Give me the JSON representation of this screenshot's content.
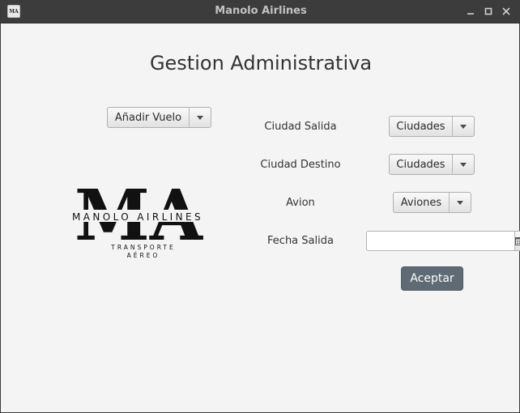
{
  "window": {
    "title": "Manolo Airlines",
    "icon_text": "MA"
  },
  "heading": "Gestion Administrativa",
  "menu": {
    "add_flight_label": "Añadir Vuelo"
  },
  "logo": {
    "monogram": "MA",
    "name": "MANOLO AIRLINES",
    "tagline_1": "TRANSPORTE",
    "tagline_2": "AÉREO"
  },
  "form": {
    "origin_label": "Ciudad Salida",
    "origin_value": "Ciudades",
    "destination_label": "Ciudad Destino",
    "destination_value": "Ciudades",
    "plane_label": "Avion",
    "plane_value": "Aviones",
    "date_label": "Fecha Salida",
    "date_value": "",
    "submit_label": "Aceptar"
  },
  "colors": {
    "window_background": "#f4f4f4",
    "titlebar_background": "#3c3c3c",
    "accent_button": "#5e6a74"
  },
  "icons": {
    "minimize": "minimize-icon",
    "maximize": "maximize-icon",
    "close": "close-icon",
    "calendar": "calendar-icon",
    "dropdown": "chevron-down-icon"
  }
}
